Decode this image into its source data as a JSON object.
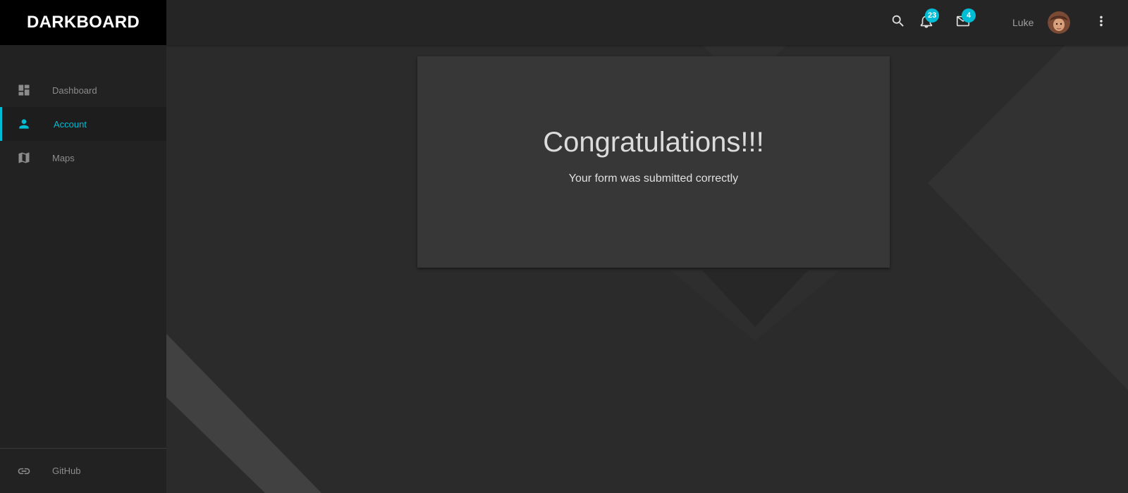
{
  "app": {
    "brand": "DARKBOARD"
  },
  "colors": {
    "accent": "#00bcd4",
    "sidebar_bg": "#222222",
    "topbar_bg": "#252525",
    "content_bg": "#2b2b2b",
    "card_bg": "#373737"
  },
  "sidebar": {
    "items": [
      {
        "label": "Dashboard",
        "icon": "dashboard-icon",
        "active": false
      },
      {
        "label": "Account",
        "icon": "person-icon",
        "active": true
      },
      {
        "label": "Maps",
        "icon": "map-icon",
        "active": false
      }
    ],
    "footer": {
      "label": "GitHub",
      "icon": "link-icon"
    }
  },
  "topbar": {
    "search_icon": "search-icon",
    "notifications": {
      "icon": "bell-icon",
      "count": "23"
    },
    "messages": {
      "icon": "mail-icon",
      "count": "4"
    },
    "user": {
      "name": "Luke",
      "avatar": "avatar"
    },
    "menu_icon": "more-vertical-icon"
  },
  "card": {
    "title": "Congratulations!!!",
    "subtitle": "Your form was submitted correctly"
  }
}
